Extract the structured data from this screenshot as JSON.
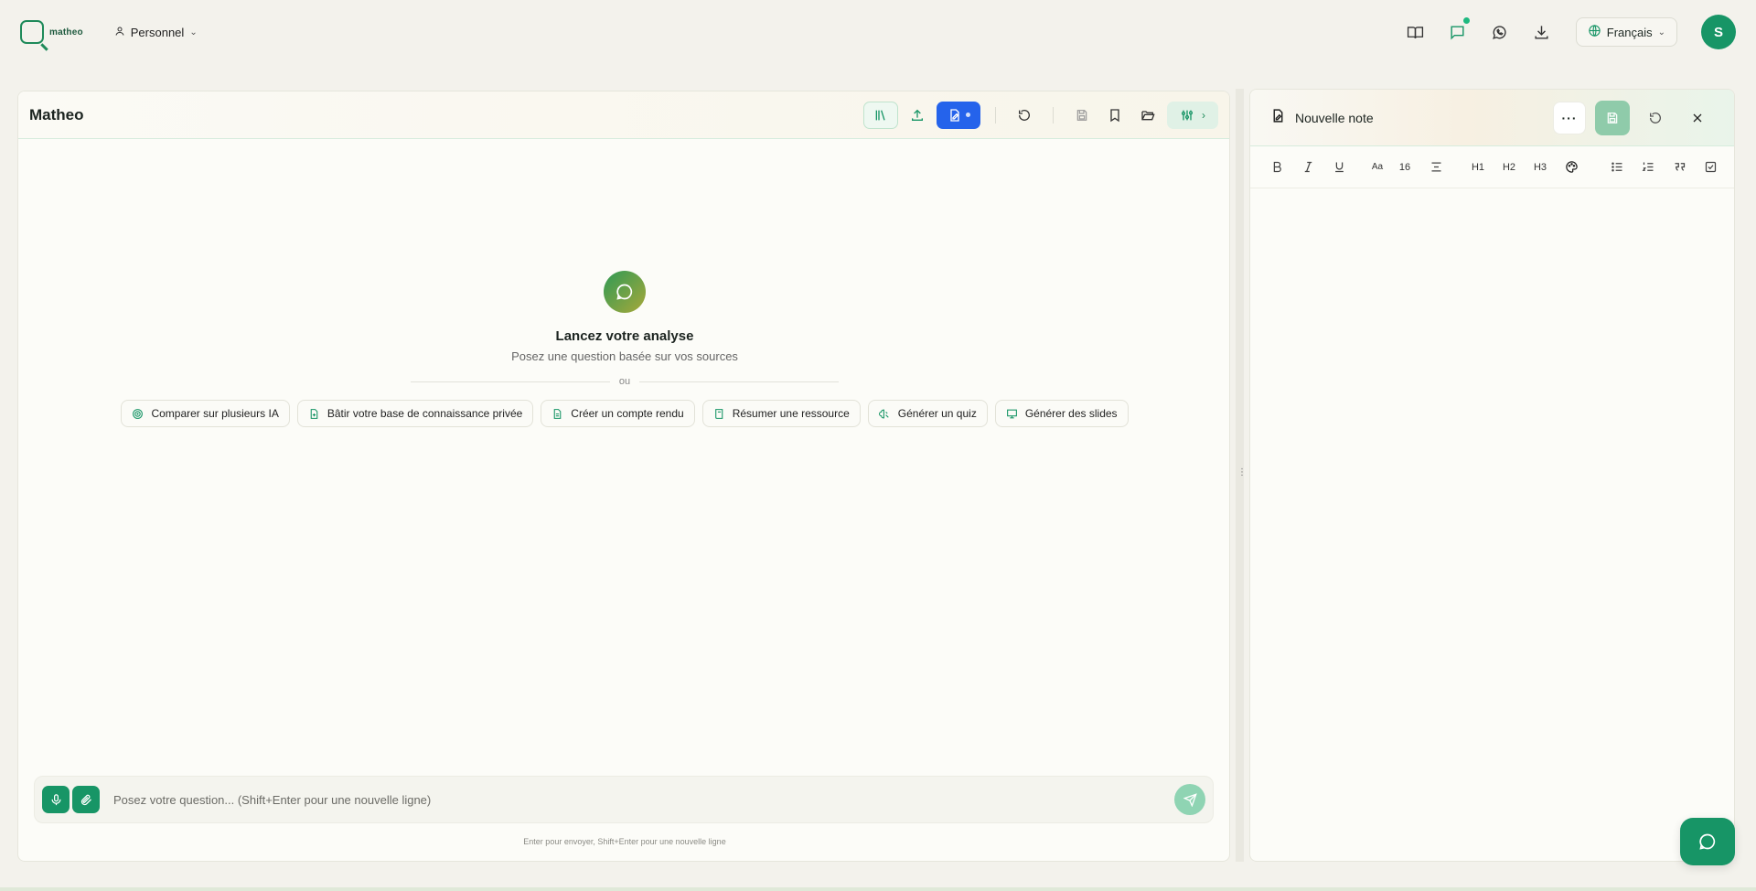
{
  "brand": {
    "name": "matheo"
  },
  "topbar": {
    "workspace": "Personnel",
    "language": "Français",
    "avatar_initial": "S"
  },
  "chat": {
    "title": "Matheo",
    "empty_title": "Lancez votre analyse",
    "empty_subtitle": "Posez une question basée sur vos sources",
    "or": "ou",
    "suggestions": [
      {
        "label": "Comparer sur plusieurs IA",
        "icon": "target-icon"
      },
      {
        "label": "Bâtir votre base de connaissance privée",
        "icon": "document-icon"
      },
      {
        "label": "Créer un compte rendu",
        "icon": "document-icon"
      },
      {
        "label": "Résumer une ressource",
        "icon": "book-icon"
      },
      {
        "label": "Générer un quiz",
        "icon": "brain-icon"
      },
      {
        "label": "Générer des slides",
        "icon": "presentation-icon"
      }
    ],
    "input_placeholder": "Posez votre question... (Shift+Enter pour une nouvelle ligne)",
    "hint": "Enter pour envoyer, Shift+Enter pour une nouvelle ligne"
  },
  "note": {
    "title": "Nouvelle note",
    "more_label": "···",
    "font_size": "16",
    "headings": [
      "H1",
      "H2",
      "H3"
    ]
  },
  "colors": {
    "accent": "#179566",
    "primary_blue": "#2563eb",
    "background": "#f3f2ec"
  }
}
